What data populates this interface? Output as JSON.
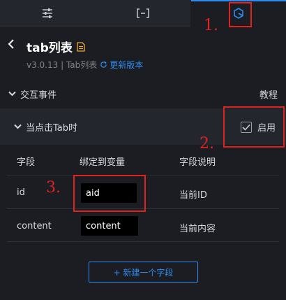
{
  "tabs": [
    {
      "icon": "sliders-icon"
    },
    {
      "icon": "bracket-icon"
    },
    {
      "icon": "interaction-icon",
      "active": true
    }
  ],
  "header": {
    "title": "tab列表",
    "version": "v3.0.13 | Tab列表",
    "update_link": "更新版本"
  },
  "interaction_section": {
    "label": "交互事件",
    "tutorial_label": "教程"
  },
  "event": {
    "label": "当点击Tab时",
    "enable_label": "启用",
    "enabled": true
  },
  "fields_table": {
    "headers": [
      "字段",
      "绑定到变量",
      "字段说明"
    ],
    "rows": [
      {
        "field": "id",
        "variable": "aid",
        "description": "当前ID"
      },
      {
        "field": "content",
        "variable": "content",
        "description": "当前内容"
      }
    ]
  },
  "add_field_button": "+ 新建一个字段",
  "annotations": [
    "1.",
    "2.",
    "3."
  ],
  "colors": {
    "accent": "#2e8cf0",
    "annotation": "#e0231f",
    "background": "#1b1d22"
  }
}
